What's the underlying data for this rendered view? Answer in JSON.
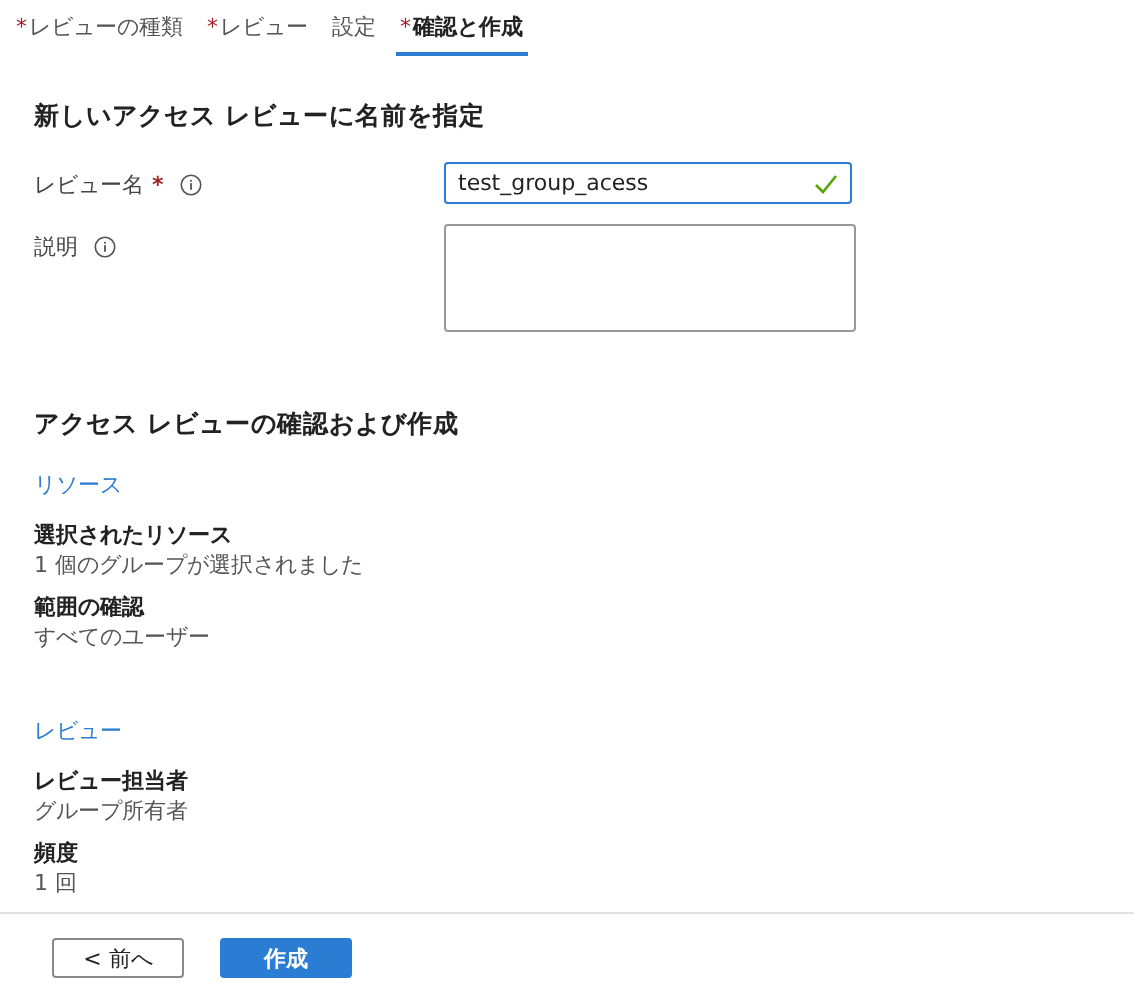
{
  "tabs": [
    {
      "label": "レビューの種類",
      "required_mark": "*",
      "selected": false
    },
    {
      "label": "レビュー",
      "required_mark": "*",
      "selected": false
    },
    {
      "label": "設定",
      "selected": false
    },
    {
      "label": "確認と作成",
      "required_mark": "*",
      "selected": true
    }
  ],
  "name_section": {
    "title": "新しいアクセス レビューに名前を指定",
    "fields": [
      {
        "kind": "input",
        "label": "レビュー名",
        "required_mark": "*",
        "value": "test_group_acess",
        "valid": true
      },
      {
        "kind": "textarea",
        "label": "説明"
      }
    ]
  },
  "review_section": {
    "title": "アクセス レビューの確認および作成",
    "groups": [
      {
        "heading": "リソース",
        "items": [
          {
            "label": "選択されたリソース",
            "value": "1 個のグループが選択されました"
          },
          {
            "label": "範囲の確認",
            "value": "すべてのユーザー"
          }
        ]
      },
      {
        "heading": "レビュー",
        "items": [
          {
            "label": "レビュー担当者",
            "value": "グループ所有者"
          },
          {
            "label": "頻度",
            "value": "1 回"
          }
        ]
      }
    ]
  },
  "footer": {
    "buttons": [
      {
        "label": "< 前へ",
        "kind": "secondary"
      },
      {
        "label": "作成",
        "kind": "primary"
      }
    ]
  }
}
